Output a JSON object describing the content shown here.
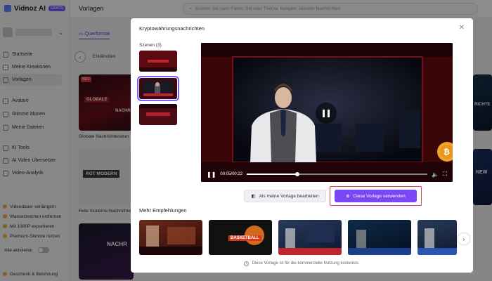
{
  "brand": {
    "name": "Vidnoz AI",
    "badge": "GRATIS"
  },
  "nav": {
    "items": [
      {
        "label": "Startseite"
      },
      {
        "label": "Meine Kreationen"
      },
      {
        "label": "Vorlagen"
      },
      {
        "label": "Avatare"
      },
      {
        "label": "Stimme Monen"
      },
      {
        "label": "Meine Dateien"
      },
      {
        "label": "KI Tools"
      },
      {
        "label": "AI Video Übersetzer"
      },
      {
        "label": "Video-Analytik"
      }
    ],
    "promos": [
      {
        "label": "Videodauer verlängern"
      },
      {
        "label": "Wasserzeichen entfernen"
      },
      {
        "label": "Mit 1080P exportieren"
      },
      {
        "label": "Premium-Stimme nutzen"
      }
    ],
    "toggle_label": "Alle aktivieren",
    "bottom_label": "Geschenk & Belohnung"
  },
  "header": {
    "title": "Vorlagen",
    "search_placeholder": "Suchen Sie nach Farbe, Stil oder Thema. Beispiel: Aktuelle Nachrichten"
  },
  "content": {
    "tab_active": "Querformat",
    "category_label": "Erklärvideo",
    "badge_new": "NEU",
    "cards": [
      {
        "caption": "Globale Nachrichtenstun"
      },
      {
        "caption": "Rote moderne Nachrichte"
      }
    ],
    "card_texts": [
      "GLOBALE",
      "NACHRICH",
      "ROT MODERN",
      "NACHR"
    ],
    "right_edge_texts": [
      "RICHTE",
      "NEW"
    ]
  },
  "modal": {
    "title": "Kryptowährungsnachrichten",
    "scenes_label": "Szenen (3)",
    "time": "00:05/00:22",
    "progress": 0.28,
    "edit_button": "Als meine Vorlage bearbeiten",
    "use_button": "Diese Vorlage verwenden",
    "more_label": "Mehr Empfehlungen",
    "footer_note": "Diese Vorlage ist für die kommerzielle Nutzung kostenlos.",
    "rec_texts": [
      "BASKETBALL"
    ]
  }
}
